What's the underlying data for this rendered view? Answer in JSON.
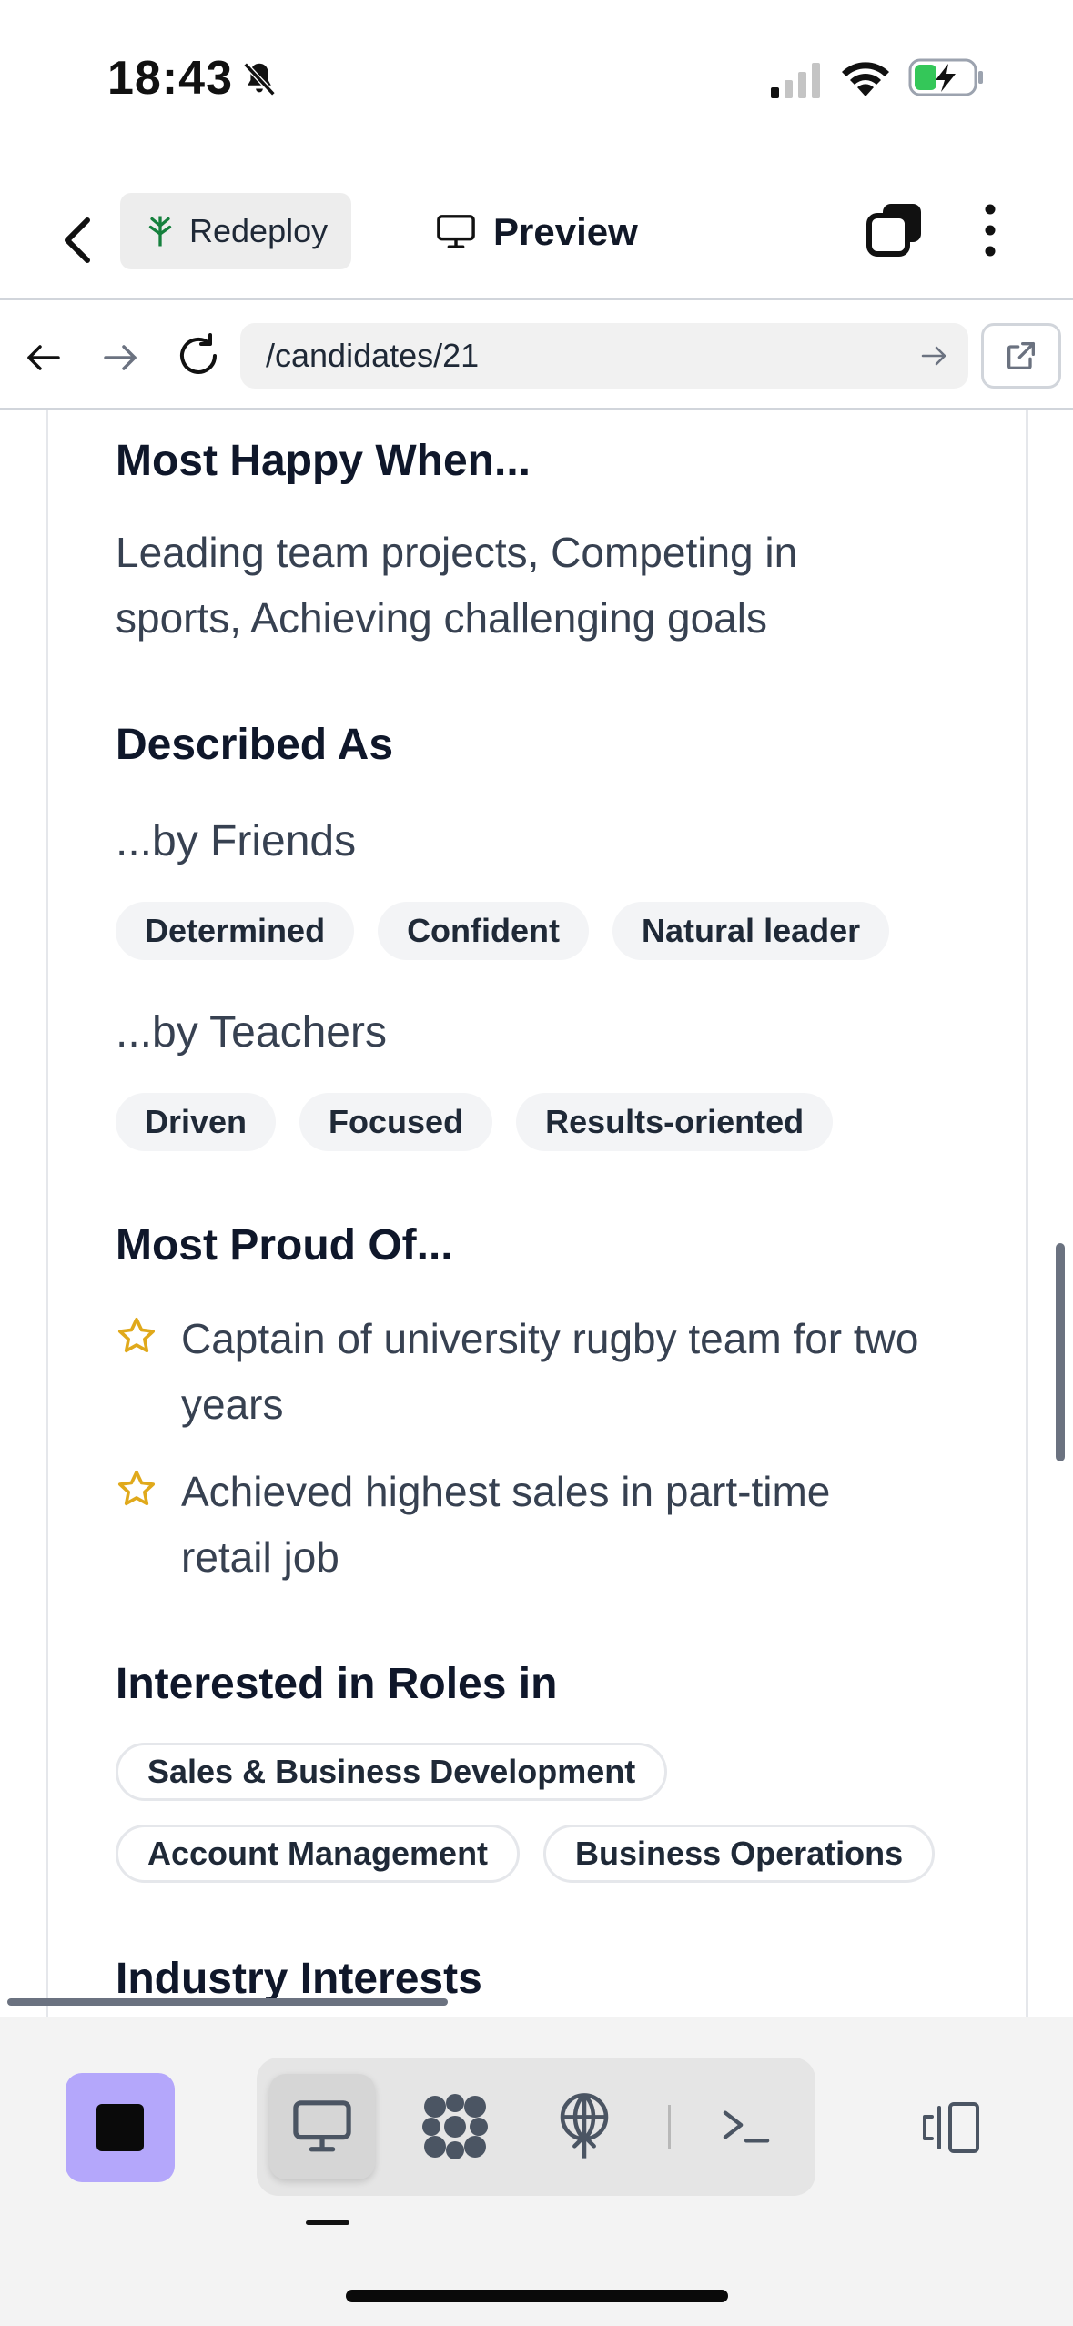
{
  "status_bar": {
    "time": "18:43"
  },
  "toolbar": {
    "redeploy_label": "Redeploy",
    "preview_label": "Preview"
  },
  "url_bar": {
    "url": "/candidates/21"
  },
  "profile": {
    "happy_heading": "Most Happy When...",
    "happy_text": "Leading team projects, Competing in sports, Achieving challenging goals",
    "described_heading": "Described As",
    "friends_heading": "...by Friends",
    "friends_traits": [
      "Determined",
      "Confident",
      "Natural leader"
    ],
    "teachers_heading": "...by Teachers",
    "teachers_traits": [
      "Driven",
      "Focused",
      "Results-oriented"
    ],
    "proud_heading": "Most Proud Of...",
    "proud_items": [
      "Captain of university rugby team for two years",
      "Achieved highest sales in part-time retail job"
    ],
    "roles_heading": "Interested in Roles in",
    "roles": [
      "Sales & Business Development",
      "Account Management",
      "Business Operations"
    ],
    "industry_heading": "Industry Interests"
  },
  "colors": {
    "accent_purple": "#b4a7fb",
    "star_gold": "#e0a91b",
    "chip_bg": "#f3f4f6"
  },
  "dock": {
    "icons": [
      "stop-icon",
      "desktop-icon",
      "apps-icon",
      "deploy-icon",
      "terminal-icon",
      "split-view-icon"
    ]
  }
}
